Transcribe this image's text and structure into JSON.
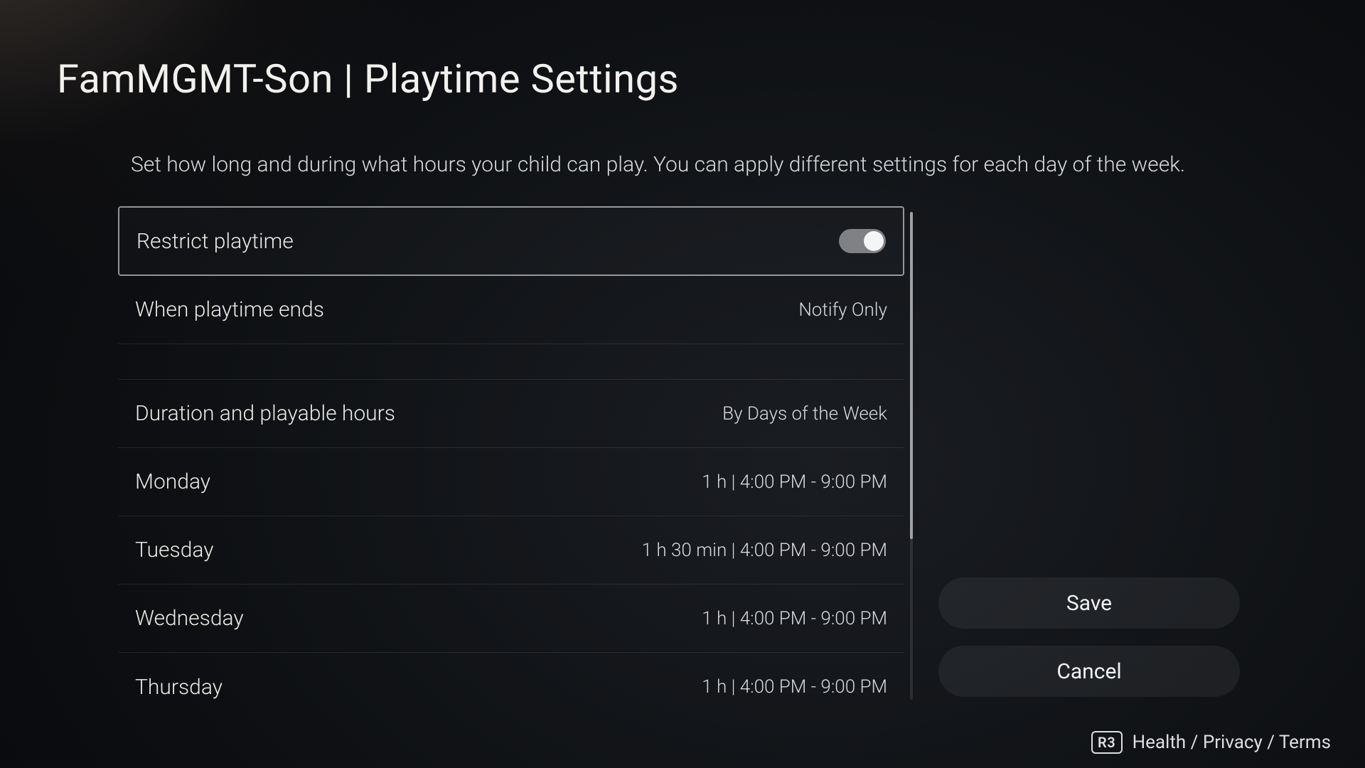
{
  "title": "FamMGMT-Son | Playtime Settings",
  "description": "Set how long and during what hours your child can play. You can apply different settings for each day of the week.",
  "rows": {
    "restrict": {
      "label": "Restrict playtime",
      "toggle_on": true
    },
    "when_ends": {
      "label": "When playtime ends",
      "value": "Notify Only"
    },
    "duration_mode": {
      "label": "Duration and playable hours",
      "value": "By Days of the Week"
    },
    "days": [
      {
        "label": "Monday",
        "value": "1 h | 4:00 PM - 9:00 PM"
      },
      {
        "label": "Tuesday",
        "value": "1 h 30 min | 4:00 PM - 9:00 PM"
      },
      {
        "label": "Wednesday",
        "value": "1 h | 4:00 PM - 9:00 PM"
      },
      {
        "label": "Thursday",
        "value": "1 h | 4:00 PM - 9:00 PM"
      }
    ]
  },
  "buttons": {
    "save": "Save",
    "cancel": "Cancel"
  },
  "footer": {
    "r3": "R3",
    "legal": "Health / Privacy / Terms"
  }
}
